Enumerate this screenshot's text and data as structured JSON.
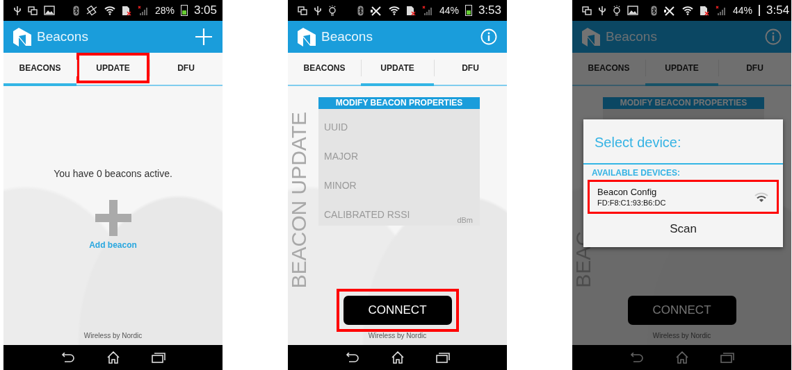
{
  "phones": [
    {
      "status_bar": {
        "notification_icons": [
          {
            "kind": "usb"
          },
          {
            "kind": "window"
          },
          {
            "kind": "image"
          }
        ],
        "system_icons": [
          {
            "kind": "bluetooth"
          },
          {
            "kind": "vibrate"
          },
          {
            "kind": "wifi"
          },
          {
            "kind": "sim"
          },
          {
            "kind": "signal"
          }
        ],
        "battery": "28%",
        "time": "3:05"
      },
      "app_bar": {
        "title": "Beacons",
        "action": {
          "kind": "add"
        }
      },
      "tabs": [
        {
          "label": "BEACONS",
          "selected": true,
          "highlighted": false
        },
        {
          "label": "UPDATE",
          "selected": false,
          "highlighted": true
        },
        {
          "label": "DFU",
          "selected": false,
          "highlighted": false
        }
      ],
      "screen": {
        "kind": "beacons",
        "message": "You have 0 beacons active.",
        "add_label": "Add beacon"
      },
      "footer": "Wireless by Nordic",
      "dimmed": false
    },
    {
      "status_bar": {
        "notification_icons": [
          {
            "kind": "window"
          },
          {
            "kind": "usb"
          },
          {
            "kind": "bulb"
          }
        ],
        "system_icons": [
          {
            "kind": "bluetooth"
          },
          {
            "kind": "mute"
          },
          {
            "kind": "wifi"
          },
          {
            "kind": "sim"
          },
          {
            "kind": "signal"
          }
        ],
        "battery": "44%",
        "time": "3:53"
      },
      "app_bar": {
        "title": "Beacons",
        "action": {
          "kind": "info"
        }
      },
      "tabs": [
        {
          "label": "BEACONS",
          "selected": false,
          "highlighted": false
        },
        {
          "label": "UPDATE",
          "selected": true,
          "highlighted": false
        },
        {
          "label": "DFU",
          "selected": false,
          "highlighted": false
        }
      ],
      "screen": {
        "kind": "update",
        "side_label": "BEACON UPDATE",
        "card_title": "MODIFY BEACON PROPERTIES",
        "fields": [
          {
            "placeholder": "UUID"
          },
          {
            "placeholder": "MAJOR"
          },
          {
            "placeholder": "MINOR"
          },
          {
            "placeholder": "CALIBRATED RSSI",
            "unit": "dBm"
          }
        ],
        "button": {
          "label": "CONNECT",
          "highlighted": true
        }
      },
      "footer": "Wireless by Nordic",
      "dimmed": false
    },
    {
      "status_bar": {
        "notification_icons": [
          {
            "kind": "window"
          },
          {
            "kind": "usb"
          },
          {
            "kind": "bulb"
          },
          {
            "kind": "image"
          }
        ],
        "system_icons": [
          {
            "kind": "bluetooth"
          },
          {
            "kind": "mute"
          },
          {
            "kind": "wifi"
          },
          {
            "kind": "sim"
          },
          {
            "kind": "signal"
          }
        ],
        "battery": "44%",
        "time": "3:54"
      },
      "app_bar": {
        "title": "Beacons",
        "action": {
          "kind": "info"
        }
      },
      "tabs": [
        {
          "label": "BEACONS",
          "selected": false,
          "highlighted": false
        },
        {
          "label": "UPDATE",
          "selected": true,
          "highlighted": false
        },
        {
          "label": "DFU",
          "selected": false,
          "highlighted": false
        }
      ],
      "screen": {
        "kind": "update",
        "side_label": "BEAC",
        "card_title": "MODIFY BEACON PROPERTIES",
        "button": {
          "label": "CONNECT",
          "highlighted": false
        }
      },
      "footer": "Wireless by Nordic",
      "dimmed": true,
      "dialog": {
        "title": "Select device:",
        "section": "AVAILABLE DEVICES:",
        "devices": [
          {
            "name": "Beacon Config",
            "address": "FD:F8:C1:93:B6:DC",
            "highlighted": true
          }
        ],
        "button": "Scan"
      }
    }
  ]
}
